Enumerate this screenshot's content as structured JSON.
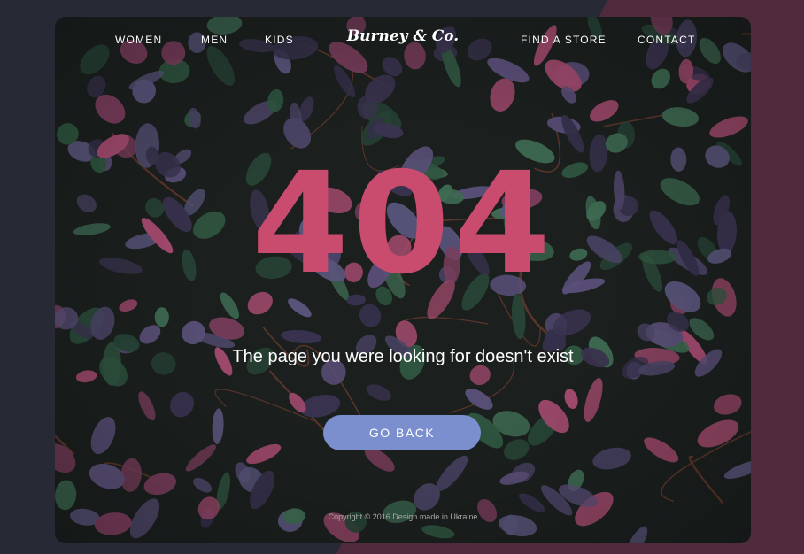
{
  "nav": {
    "women": "WOMEN",
    "men": "MEN",
    "kids": "KIDS",
    "brand": "Burney & Co.",
    "find_store": "FIND A STORE",
    "contact": "CONTACT"
  },
  "error": {
    "code": "404",
    "message": "The page you were looking for doesn't exist"
  },
  "actions": {
    "go_back": "GO BACK"
  },
  "footer": {
    "copyright": "Copyright © 2016 Design made in Ukraine"
  },
  "colors": {
    "accent": "#c94c6e",
    "button": "#7b8fcf",
    "backdrop_left": "#272a35",
    "backdrop_right": "#4f2a3c"
  },
  "background": {
    "image": "dark foliage with purple, green and pink leaves"
  }
}
